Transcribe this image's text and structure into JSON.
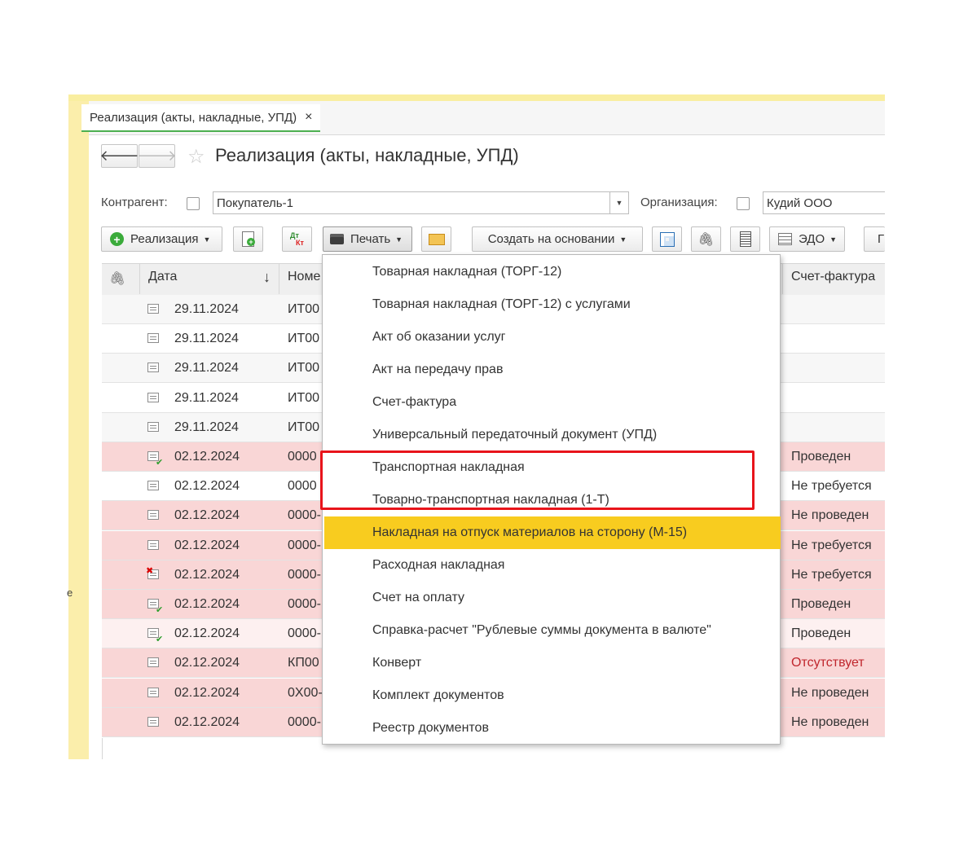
{
  "tab": {
    "label": "Реализация (акты, накладные, УПД)",
    "close": "×"
  },
  "nav": {
    "back": "🡐",
    "forward": "🡒"
  },
  "page_title": "Реализация (акты, накладные, УПД)",
  "filters": {
    "counterparty_label": "Контрагент:",
    "counterparty_value": "Покупатель-1",
    "organization_label": "Организация:",
    "organization_value": "Кудий ООО"
  },
  "toolbar": {
    "create_label": "Реализация",
    "dtkt_top": "Дт",
    "dtkt_bottom": "Кт",
    "print_label": "Печать",
    "create_based_label": "Создать на основании",
    "edo_label": "ЭДО",
    "more_label": "Г"
  },
  "columns": {
    "date": "Дата",
    "sort": "↓",
    "number": "Номе",
    "invoice": "Счет-фактура"
  },
  "rows": [
    {
      "date": "29.11.2024",
      "number": "ИТ00",
      "status": "",
      "bg": "#f7f7f7",
      "mark": ""
    },
    {
      "date": "29.11.2024",
      "number": "ИТ00",
      "status": "",
      "bg": "#ffffff",
      "mark": ""
    },
    {
      "date": "29.11.2024",
      "number": "ИТ00",
      "status": "",
      "bg": "#f7f7f7",
      "mark": ""
    },
    {
      "date": "29.11.2024",
      "number": "ИТ00",
      "status": "",
      "bg": "#ffffff",
      "mark": ""
    },
    {
      "date": "29.11.2024",
      "number": "ИТ00",
      "status": "",
      "bg": "#f7f7f7",
      "mark": ""
    },
    {
      "date": "02.12.2024",
      "number": "0000",
      "status": "Проведен",
      "bg": "#f9d6d6",
      "mark": "check"
    },
    {
      "date": "02.12.2024",
      "number": "0000",
      "status": "Не требуется",
      "bg": "#ffffff",
      "mark": ""
    },
    {
      "date": "02.12.2024",
      "number": "0000-",
      "status": "Не проведен",
      "bg": "#f9d6d6",
      "mark": ""
    },
    {
      "date": "02.12.2024",
      "number": "0000-",
      "status": "Не требуется",
      "bg": "#f9d6d6",
      "mark": ""
    },
    {
      "date": "02.12.2024",
      "number": "0000-",
      "status": "Не требуется",
      "bg": "#f9d6d6",
      "mark": "x"
    },
    {
      "date": "02.12.2024",
      "number": "0000-",
      "status": "Проведен",
      "bg": "#f9d6d6",
      "mark": "check"
    },
    {
      "date": "02.12.2024",
      "number": "0000-",
      "status": "Проведен",
      "bg": "#fdf0f0",
      "mark": "check"
    },
    {
      "date": "02.12.2024",
      "number": "КП00",
      "status": "Отсутствует",
      "bg": "#f9d6d6",
      "mark": "",
      "status_color": "#c0262d"
    },
    {
      "date": "02.12.2024",
      "number": "0Х00-",
      "status": "Не проведен",
      "bg": "#f9d6d6",
      "mark": ""
    },
    {
      "date": "02.12.2024",
      "number": "0000-",
      "status": "Не проведен",
      "bg": "#f9d6d6",
      "mark": ""
    }
  ],
  "print_menu": [
    "Товарная накладная (ТОРГ-12)",
    "Товарная накладная (ТОРГ-12) с услугами",
    "Акт об оказании услуг",
    "Акт на передачу прав",
    "Счет-фактура",
    "Универсальный передаточный документ (УПД)",
    "Транспортная накладная",
    "Товарно-транспортная накладная (1-Т)",
    "Накладная на отпуск материалов на сторону (М-15)",
    "Расходная накладная",
    "Счет на оплату",
    "Справка-расчет \"Рублевые суммы документа в валюте\"",
    "Конверт",
    "Комплект документов",
    "Реестр документов"
  ],
  "highlighted_menu_index": 8,
  "colors": {
    "accent_green": "#4caf50",
    "highlight": "#f8cc1f",
    "annotation_red": "#e8141b"
  }
}
